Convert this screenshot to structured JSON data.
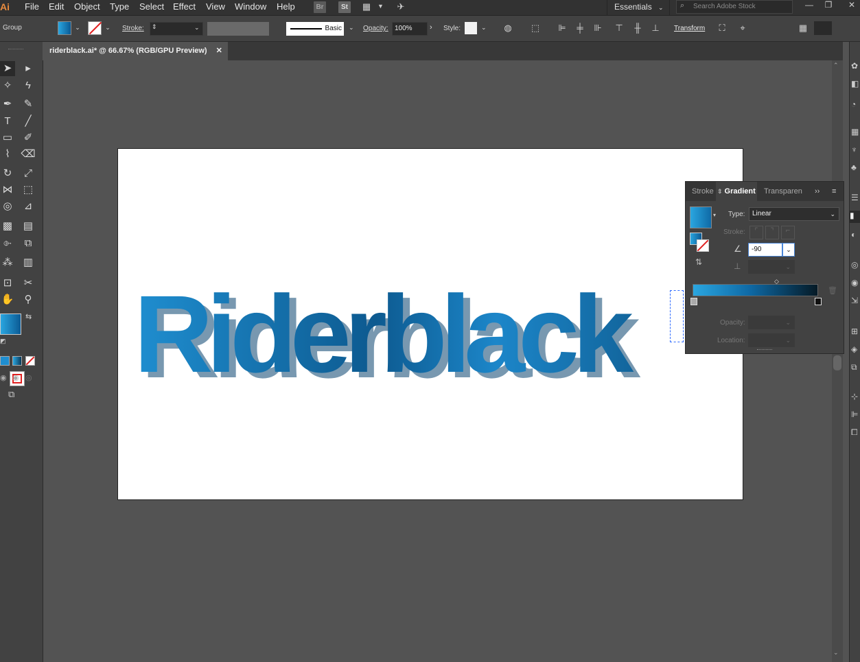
{
  "app": {
    "logo": "Ai",
    "document_tab": "riderblack.ai* @ 66.67% (RGB/GPU Preview)",
    "close_glyph": "✕"
  },
  "menu": [
    "File",
    "Edit",
    "Object",
    "Type",
    "Select",
    "Effect",
    "View",
    "Window",
    "Help"
  ],
  "bridge": {
    "br": "Br",
    "st": "St"
  },
  "workspace": {
    "label": "Essentials"
  },
  "search": {
    "placeholder": "Search Adobe Stock"
  },
  "control_bar": {
    "selection": "Group",
    "stroke_label": "Stroke:",
    "brush_label": "Basic",
    "opacity_label": "Opacity:",
    "opacity_value": "100%",
    "style_label": "Style:",
    "transform_label": "Transform"
  },
  "artwork": {
    "text": "Riderblack"
  },
  "gradient_panel": {
    "tabs": [
      "Stroke",
      "Gradient",
      "Transparen"
    ],
    "active_tab": "Gradient",
    "type_label": "Type:",
    "type_value": "Linear",
    "stroke_label": "Stroke:",
    "angle_value": "-90",
    "opacity_label": "Opacity:",
    "location_label": "Location:",
    "gradient_start": "#2aa6e0",
    "gradient_end": "#051a26"
  },
  "colors": {
    "accent_blue": "#1f8ed0",
    "ui_dark": "#323232",
    "ui_mid": "#424242",
    "canvas": "#535353"
  }
}
